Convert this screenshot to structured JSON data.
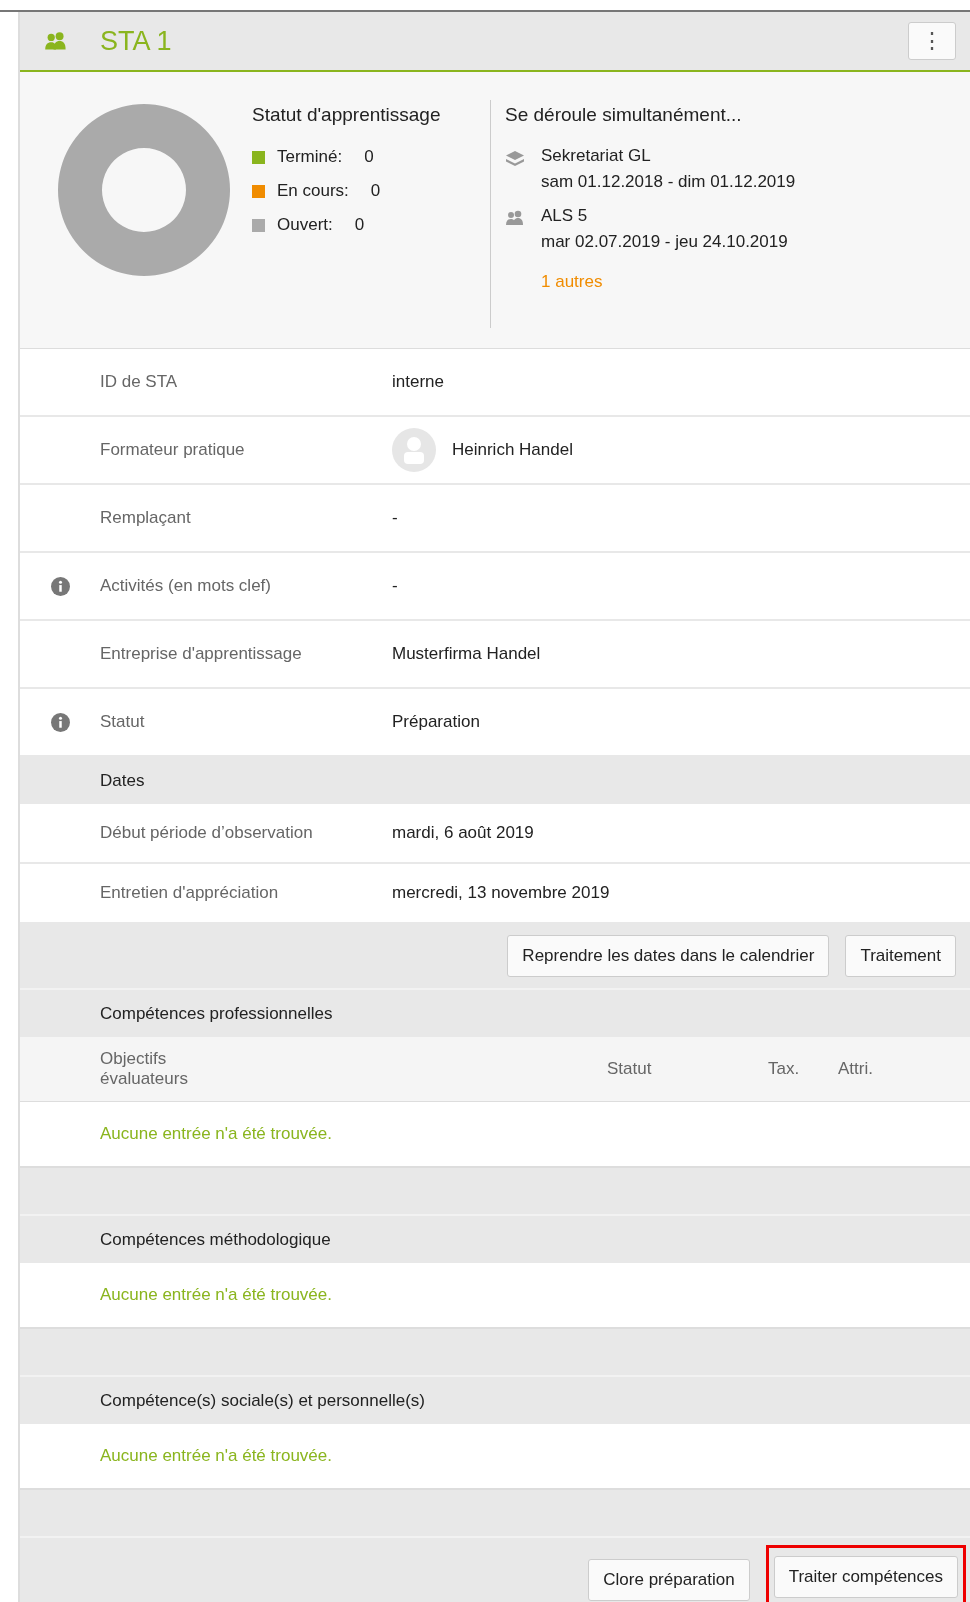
{
  "header": {
    "title": "STA 1",
    "menu_button": "⋮"
  },
  "summary": {
    "chart_title": "Statut d'apprentissage",
    "legend": [
      {
        "label": "Terminé:",
        "value": "0",
        "color": "#8ab51e"
      },
      {
        "label": "En cours:",
        "value": "0",
        "color": "#f08c00"
      },
      {
        "label": "Ouvert:",
        "value": "0",
        "color": "#aaaaaa"
      }
    ],
    "concurrent_title": "Se déroule simultanément...",
    "concurrent": [
      {
        "kind": "layers",
        "name": "Sekretariat GL",
        "dates": "sam 01.12.2018 - dim 01.12.2019"
      },
      {
        "kind": "group",
        "name": "ALS 5",
        "dates": "mar 02.07.2019 - jeu 24.10.2019"
      }
    ],
    "more_link": "1 autres"
  },
  "details": [
    {
      "label": "ID de STA",
      "value": "interne",
      "info": false,
      "kind": "text"
    },
    {
      "label": "Formateur pratique",
      "value": "Heinrich Handel",
      "info": false,
      "kind": "person"
    },
    {
      "label": "Remplaçant",
      "value": "-",
      "info": false,
      "kind": "text"
    },
    {
      "label": "Activités (en mots clef)",
      "value": "-",
      "info": true,
      "kind": "text"
    },
    {
      "label": "Entreprise d'apprentissage",
      "value": "Musterfirma Handel",
      "info": false,
      "kind": "text"
    },
    {
      "label": "Statut",
      "value": "Préparation",
      "info": true,
      "kind": "text"
    }
  ],
  "dates": {
    "title": "Dates",
    "rows": [
      {
        "label": "Début période d’observation",
        "value": "mardi, 6 août 2019"
      },
      {
        "label": "Entretien d'appréciation",
        "value": "mercredi, 13 novembre 2019"
      }
    ],
    "actions": [
      "Reprendre les dates dans le calendrier",
      "Traitement"
    ]
  },
  "sections": [
    {
      "title": "Compétences professionnelles",
      "columns": [
        "Objectifs évaluateurs",
        "Statut",
        "Tax.",
        "Attri."
      ],
      "empty_message": "Aucune entrée n'a été trouvée."
    },
    {
      "title": "Compétences méthodologique",
      "empty_message": "Aucune entrée n'a été trouvée."
    },
    {
      "title": "Compétence(s) sociale(s) et personnelle(s)",
      "empty_message": "Aucune entrée n'a été trouvée."
    }
  ],
  "footer_actions": [
    {
      "label": "Clore préparation",
      "highlighted": false
    },
    {
      "label": "Traiter compétences",
      "highlighted": true
    }
  ]
}
